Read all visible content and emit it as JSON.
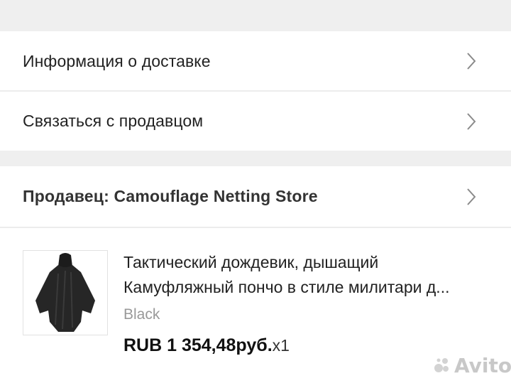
{
  "rows": {
    "delivery_label": "Информация о доставке",
    "contact_label": "Связаться с продавцом",
    "seller_label": "Продавец: Camouflage Netting Store"
  },
  "product": {
    "title_line1": "Тактический дождевик, дышащий",
    "title_line2": "Камуфляжный пончо в стиле милитари д...",
    "variant": "Black",
    "price": "RUB 1 354,48руб.",
    "quantity": "x1"
  },
  "icons": {
    "chevron": "chevron-right-icon",
    "thumbnail": "poncho-product-image",
    "watermark": "avito-logo"
  },
  "watermark": {
    "text": "Avito"
  },
  "colors": {
    "background": "#f0f0f0",
    "panel": "#ffffff",
    "muted_text": "#999999",
    "chevron": "#8a8a8a"
  }
}
